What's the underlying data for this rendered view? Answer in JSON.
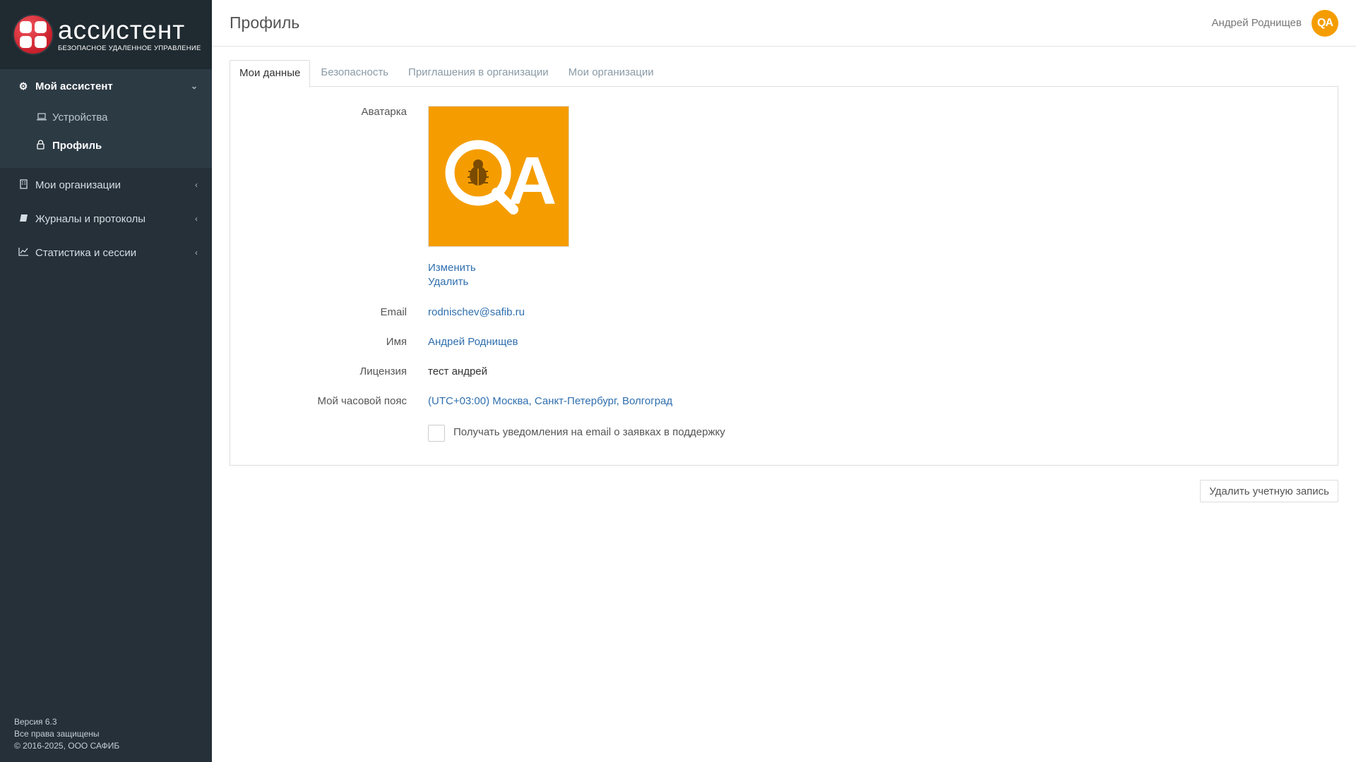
{
  "brand": {
    "name": "ассистент",
    "subtitle": "БЕЗОПАСНОЕ УДАЛЕННОЕ УПРАВЛЕНИЕ"
  },
  "sidebar": {
    "groups": [
      {
        "label": "Мой ассистент",
        "icon": "gear-icon",
        "items": [
          {
            "label": "Устройства",
            "icon": "laptop-icon"
          },
          {
            "label": "Профиль",
            "icon": "lock-icon"
          }
        ]
      },
      {
        "label": "Мои организации",
        "icon": "building-icon"
      },
      {
        "label": "Журналы и протоколы",
        "icon": "book-icon"
      },
      {
        "label": "Статистика и сессии",
        "icon": "line-chart-icon"
      }
    ],
    "footer": {
      "version": "Версия 6.3",
      "rights": "Все права защищены",
      "copyright": "© 2016-2025, ООО САФИБ"
    }
  },
  "header": {
    "title": "Профиль",
    "user_name": "Андрей Роднищев",
    "avatar_text": "QA"
  },
  "tabs": [
    "Мои данные",
    "Безопасность",
    "Приглашения в организации",
    "Мои организации"
  ],
  "profile": {
    "avatar_label": "Аватарка",
    "avatar_text": "QA",
    "change_link": "Изменить",
    "delete_link": "Удалить",
    "email_label": "Email",
    "email_value": "rodnischev@safib.ru",
    "name_label": "Имя",
    "name_value": "Андрей Роднищев",
    "license_label": "Лицензия",
    "license_value": "тест андрей",
    "timezone_label": "Мой часовой пояс",
    "timezone_value": "(UTC+03:00) Москва, Санкт-Петербург, Волгоград",
    "notify_label": "Получать уведомления на email о заявках в поддержку",
    "notify_checked": false
  },
  "actions": {
    "delete_account": "Удалить учетную запись"
  },
  "colors": {
    "sidebar_bg": "#253038",
    "link": "#2f6fae",
    "avatar_bg": "#f59d00",
    "brand_red": "#d1262f"
  }
}
